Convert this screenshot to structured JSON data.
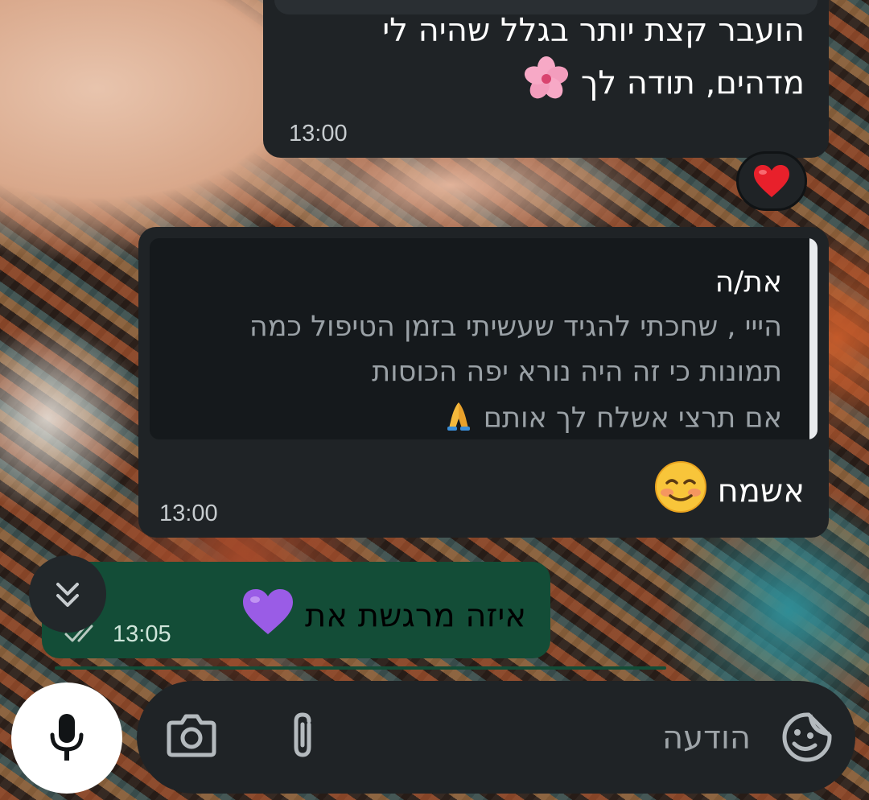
{
  "messages": [
    {
      "id": "m1",
      "direction": "incoming",
      "lines": [
        "הועבר קצת יותר בגלל שהיה לי",
        "מדהים, תודה לך"
      ],
      "emoji": "cherry-blossom",
      "time": "13:00",
      "reaction": "red-heart"
    },
    {
      "id": "m2",
      "direction": "incoming",
      "quote": {
        "sender": "את/ה",
        "lines": [
          "הייי , שחכתי להגיד שעשיתי בזמן הטיפול כמה",
          "תמונות כי זה היה נורא יפה הכוסות",
          "אם תרצי אשלח לך אותם"
        ],
        "emoji": "folded-hands"
      },
      "text": "אשמח",
      "emoji": "smiling-face",
      "time": "13:00"
    },
    {
      "id": "m3",
      "direction": "outgoing",
      "text": "איזה מרגשת את",
      "emoji": "purple-heart",
      "time": "13:05",
      "status": "read"
    }
  ],
  "composer": {
    "placeholder": "הודעה",
    "emoji_icon": "sticker-emoji-icon",
    "attach_icon": "paperclip-icon",
    "camera_icon": "camera-icon",
    "mic_icon": "microphone-icon"
  },
  "colors": {
    "incoming_bubble": "#1f2326",
    "outgoing_bubble": "#134d37",
    "accent_white": "#ffffff"
  }
}
